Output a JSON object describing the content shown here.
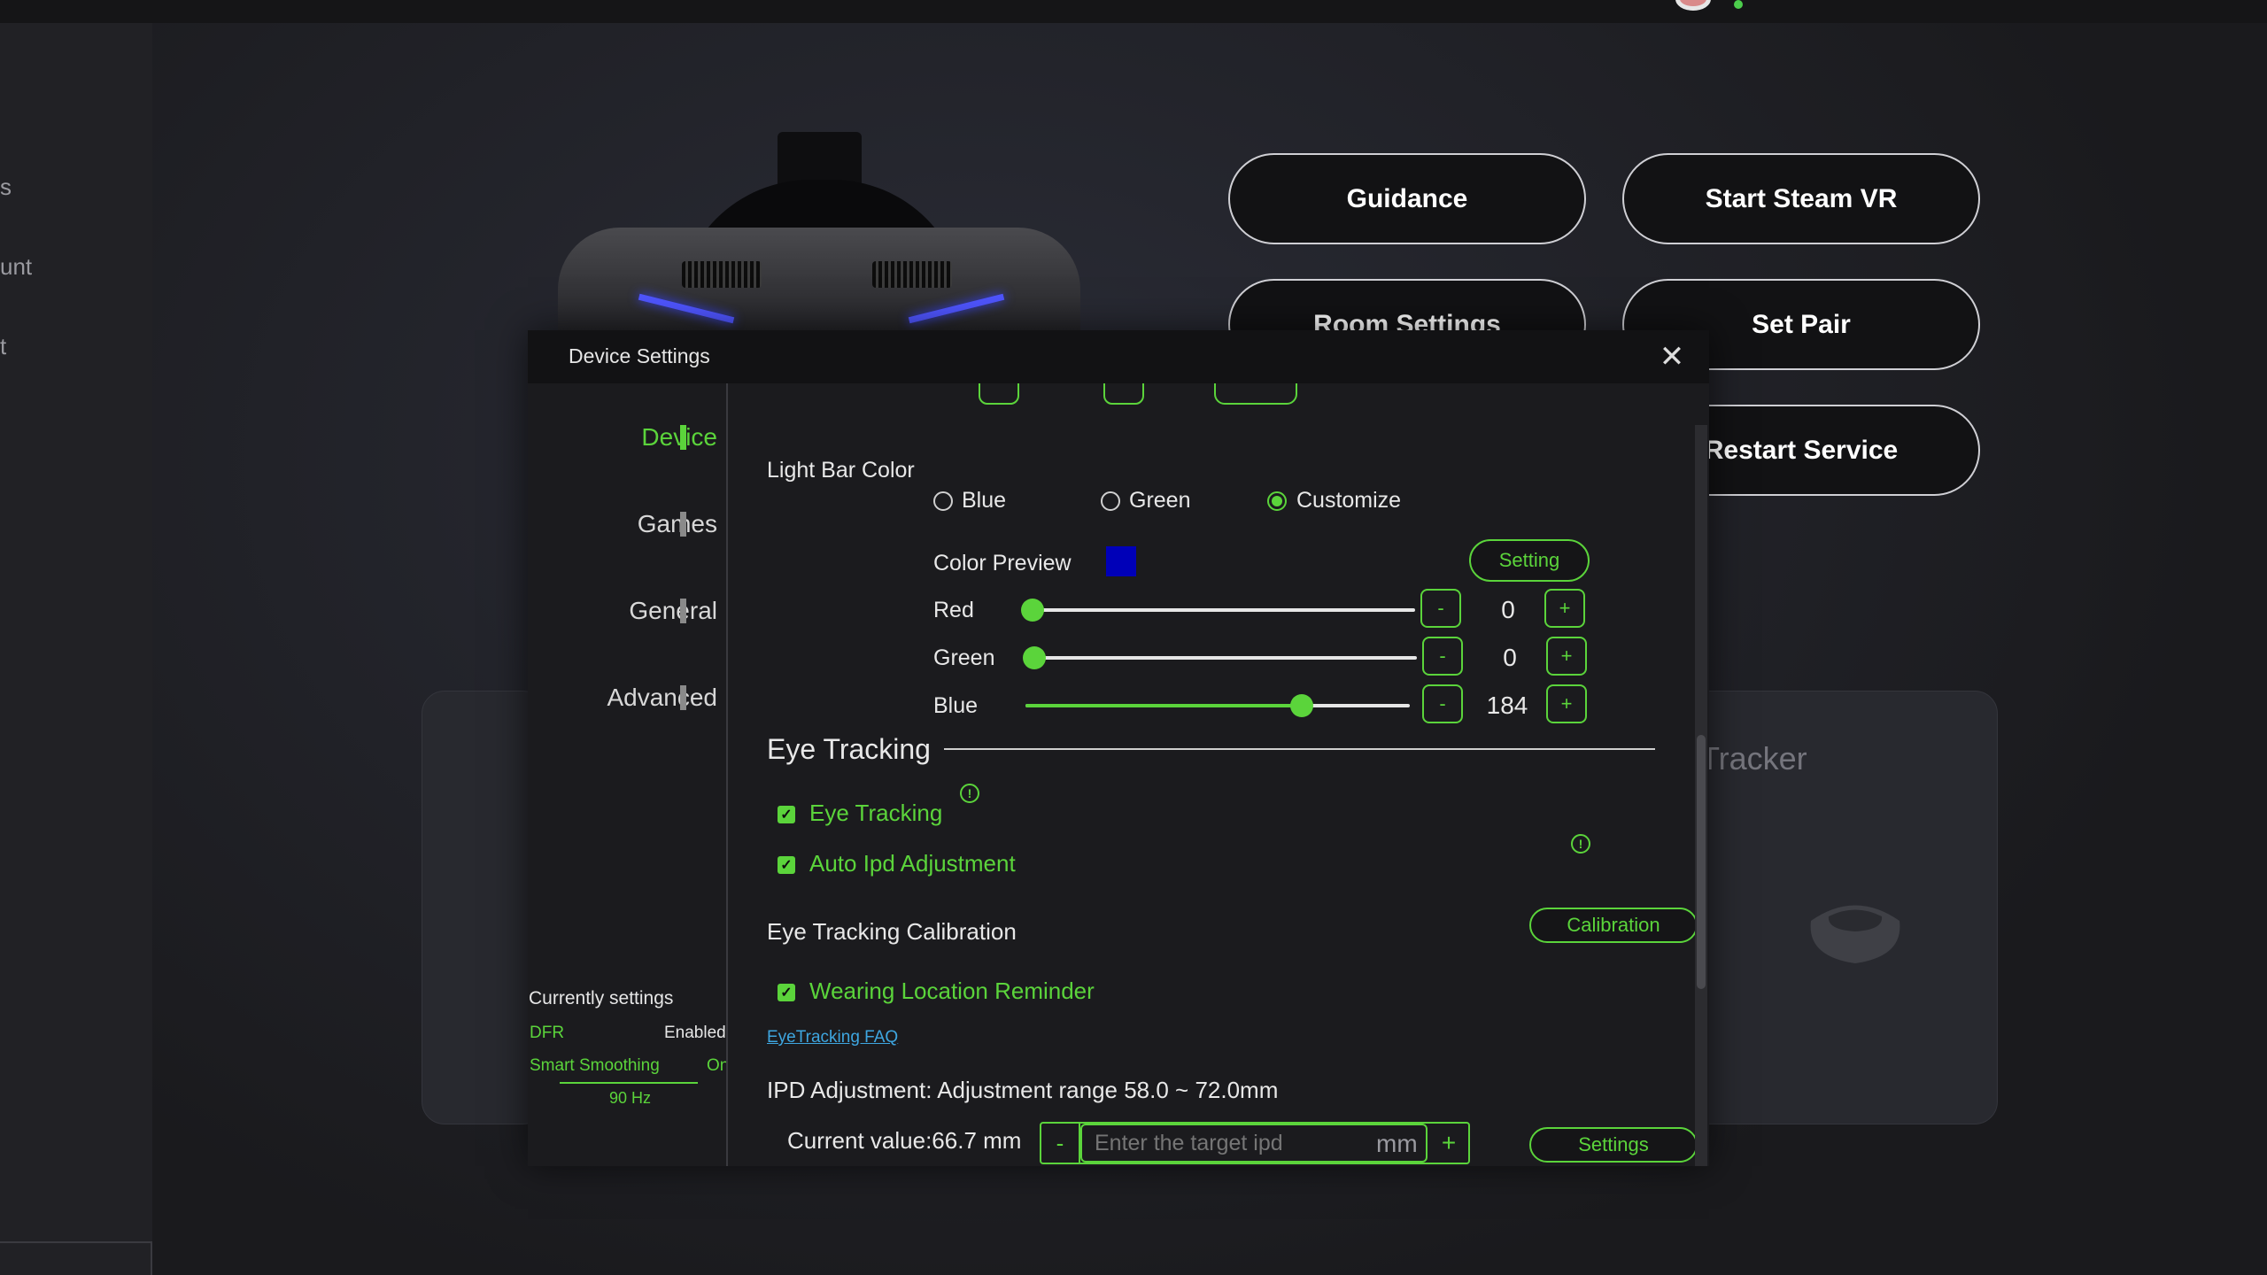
{
  "sidebar": {
    "items": [
      "s",
      "unt",
      "t"
    ]
  },
  "actions": {
    "guidance": "Guidance",
    "start_steam_vr": "Start Steam VR",
    "room_settings": "Room Settings",
    "set_pair": "Set Pair",
    "restart_service": "Restart Service"
  },
  "background": {
    "tracker_label": "Tracker"
  },
  "dialog": {
    "title": "Device Settings",
    "close_icon": "close-icon",
    "nav": [
      "Device",
      "Games",
      "General",
      "Advanced"
    ],
    "active_nav": "Device",
    "current": {
      "heading": "Currently settings",
      "dfr_label": "DFR",
      "dfr_value": "Enabled",
      "smoothing_label": "Smart Smoothing",
      "smoothing_value": "On",
      "refresh": "90 Hz"
    },
    "light_bar": {
      "label": "Light Bar Color",
      "options": [
        "Blue",
        "Green",
        "Customize"
      ],
      "selected": "Customize",
      "preview_label": "Color Preview",
      "preview_color": "#0000b8",
      "setting_button": "Setting",
      "channels": [
        {
          "name": "Red",
          "value": "0",
          "fraction": 0.0
        },
        {
          "name": "Green",
          "value": "0",
          "fraction": 0.0
        },
        {
          "name": "Blue",
          "value": "184",
          "fraction": 0.72
        }
      ],
      "minus": "-",
      "plus": "+"
    },
    "eye_tracking": {
      "section_title": "Eye Tracking",
      "eye_tracking_label": "Eye Tracking",
      "auto_ipd_label": "Auto Ipd Adjustment",
      "calibration_label": "Eye Tracking Calibration",
      "calibration_button": "Calibration",
      "wearing_reminder_label": "Wearing Location Reminder",
      "faq_link": "EyeTracking FAQ"
    },
    "ipd": {
      "label": "IPD Adjustment: Adjustment range 58.0 ~ 72.0mm",
      "current": "Current value:66.7 mm",
      "input_placeholder": "Enter the target ipd",
      "unit": "mm",
      "minus": "-",
      "plus": "+",
      "settings_button": "Settings"
    }
  },
  "colors": {
    "accent": "#5bd43b",
    "led": "#4f55ff"
  }
}
